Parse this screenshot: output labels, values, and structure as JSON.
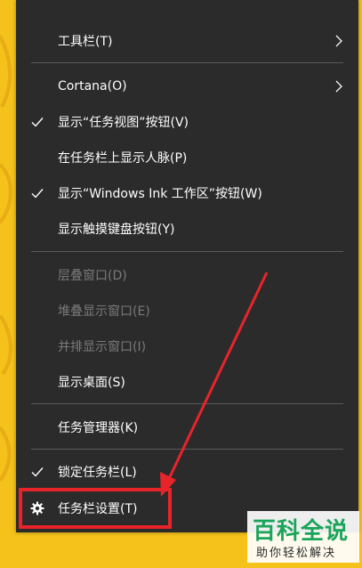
{
  "menu": {
    "items": [
      {
        "label": "工具栏(T)"
      },
      {
        "label": "Cortana(O)"
      },
      {
        "label": "显示“任务视图”按钮(V)"
      },
      {
        "label": "在任务栏上显示人脉(P)"
      },
      {
        "label": "显示“Windows Ink 工作区”按钮(W)"
      },
      {
        "label": "显示触摸键盘按钮(Y)"
      },
      {
        "label": "层叠窗口(D)"
      },
      {
        "label": "堆叠显示窗口(E)"
      },
      {
        "label": "并排显示窗口(I)"
      },
      {
        "label": "显示桌面(S)"
      },
      {
        "label": "任务管理器(K)"
      },
      {
        "label": "锁定任务栏(L)"
      },
      {
        "label": "任务栏设置(T)"
      }
    ]
  },
  "watermark": {
    "title": "百科全说",
    "subtitle": "助你轻松解决"
  },
  "colors": {
    "menu_bg": "#2b2b2b",
    "text": "#ffffff",
    "disabled_text": "#7a7a7a",
    "accent_red": "#e8242b",
    "background_yellow": "#f4c21a",
    "watermark_green": "#1aa55a"
  }
}
